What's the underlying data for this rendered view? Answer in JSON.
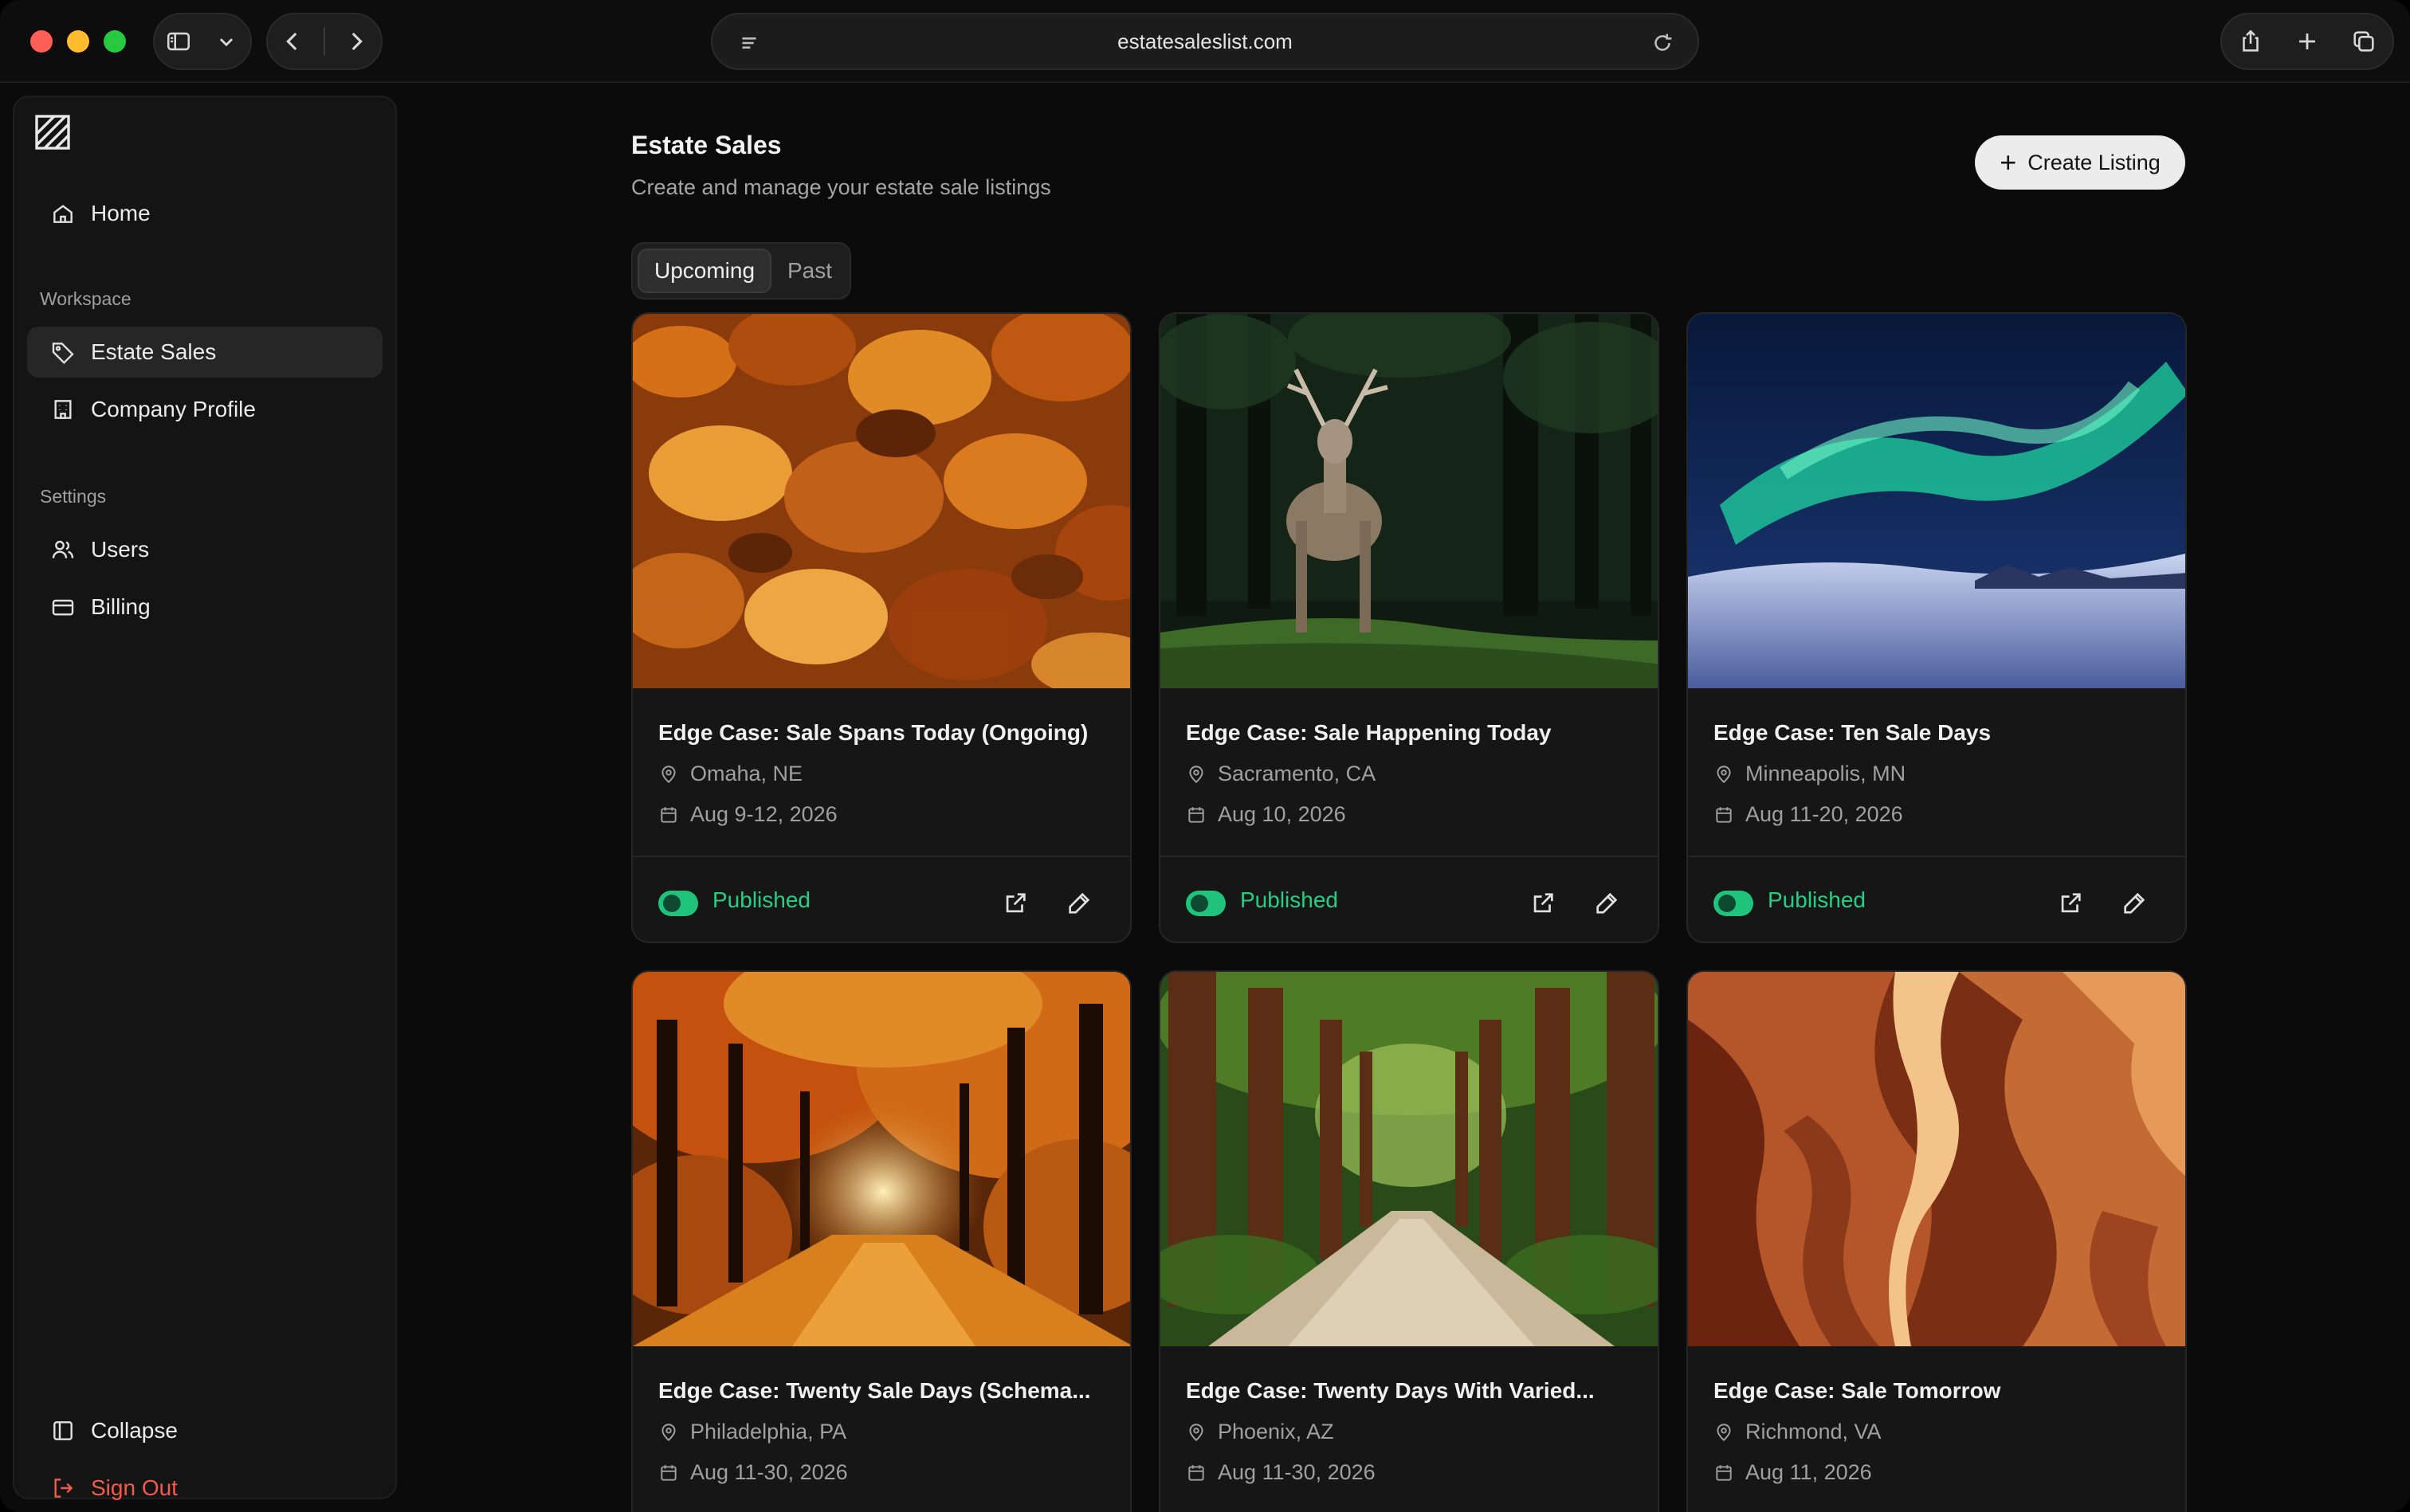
{
  "browser": {
    "url": "estatesaleslist.com"
  },
  "sidebar": {
    "home": "Home",
    "workspace_heading": "Workspace",
    "estate_sales": "Estate Sales",
    "company_profile": "Company Profile",
    "settings_heading": "Settings",
    "users": "Users",
    "billing": "Billing",
    "collapse": "Collapse",
    "sign_out": "Sign Out"
  },
  "header": {
    "title": "Estate Sales",
    "subtitle": "Create and manage your estate sale listings",
    "create_label": "Create Listing"
  },
  "tabs": {
    "upcoming": "Upcoming",
    "past": "Past"
  },
  "colors": {
    "accent_green": "#25d085",
    "danger_red": "#f25b4b"
  },
  "listings": [
    {
      "title": "Edge Case: Sale Spans Today (Ongoing)",
      "location": "Omaha, NE",
      "dates": "Aug 9-12, 2026",
      "status": "Published",
      "image": "autumn-leaves"
    },
    {
      "title": "Edge Case: Sale Happening Today",
      "location": "Sacramento, CA",
      "dates": "Aug 10, 2026",
      "status": "Published",
      "image": "stag-in-forest"
    },
    {
      "title": "Edge Case: Ten Sale Days",
      "location": "Minneapolis, MN",
      "dates": "Aug 11-20, 2026",
      "status": "Published",
      "image": "aurora-snow"
    },
    {
      "title": "Edge Case: Twenty Sale Days (Schema...",
      "location": "Philadelphia, PA",
      "dates": "Aug 11-30, 2026",
      "image": "autumn-path"
    },
    {
      "title": "Edge Case: Twenty Days With Varied...",
      "location": "Phoenix, AZ",
      "dates": "Aug 11-30, 2026",
      "image": "redwood-road"
    },
    {
      "title": "Edge Case: Sale Tomorrow",
      "location": "Richmond, VA",
      "dates": "Aug 11, 2026",
      "image": "sandstone-canyon"
    }
  ]
}
